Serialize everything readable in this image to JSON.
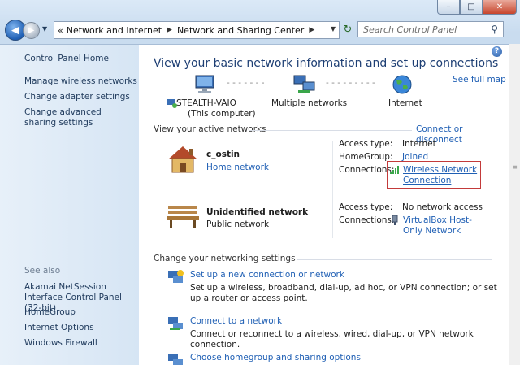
{
  "window": {
    "minimize_glyph": "–",
    "maximize_glyph": "□",
    "close_glyph": "✕"
  },
  "nav": {
    "back_glyph": "◀",
    "forward_glyph": "▶",
    "crumb_prefix": "«",
    "breadcrumb": [
      "Network and Internet",
      "Network and Sharing Center"
    ],
    "breadcrumb_sep": "▶",
    "refresh_glyph": "↻",
    "search_placeholder": "Search Control Panel"
  },
  "sidebar": {
    "items": [
      "Control Panel Home",
      "Manage wireless networks",
      "Change adapter settings",
      "Change advanced sharing settings"
    ],
    "see_also_label": "See also",
    "see_also": [
      "Akamai NetSession Interface Control Panel (32-bit)",
      "HomeGroup",
      "Internet Options",
      "Windows Firewall"
    ]
  },
  "main": {
    "title": "View your basic network information and set up connections",
    "see_full_map": "See full map",
    "map": {
      "computer": "STEALTH-VAIO",
      "computer_sub": "(This computer)",
      "networks": "Multiple networks",
      "internet": "Internet"
    },
    "active_header": "View your active networks",
    "connect_or_disconnect": "Connect or disconnect",
    "networks": [
      {
        "name": "c_ostin",
        "category": "Home network",
        "access_label": "Access type:",
        "access": "Internet",
        "homegroup_label": "HomeGroup:",
        "homegroup": "Joined",
        "connections_label": "Connections:",
        "connection": "Wireless Network Connection"
      },
      {
        "name": "Unidentified network",
        "category": "Public network",
        "access_label": "Access type:",
        "access": "No network access",
        "connections_label": "Connections:",
        "connection": "VirtualBox Host-Only Network"
      }
    ],
    "change_header": "Change your networking settings",
    "tasks": [
      {
        "title": "Set up a new connection or network",
        "desc": "Set up a wireless, broadband, dial-up, ad hoc, or VPN connection; or set up a router or access point."
      },
      {
        "title": "Connect to a network",
        "desc": "Connect or reconnect to a wireless, wired, dial-up, or VPN network connection."
      },
      {
        "title": "Choose homegroup and sharing options",
        "desc": ""
      }
    ]
  }
}
